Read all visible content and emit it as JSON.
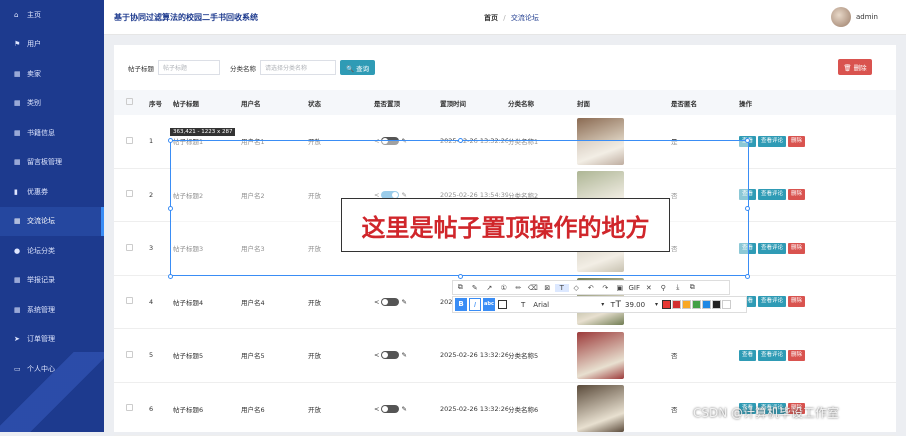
{
  "app_title": "基于协同过滤算法的校园二手书回收系统",
  "header": {
    "crumb_home": "首页",
    "crumb_sep": "/",
    "crumb_current": "交流论坛",
    "username": "admin"
  },
  "sidebar": {
    "items": [
      {
        "icon": "⌂",
        "label": "主页"
      },
      {
        "icon": "⚑",
        "label": "用户"
      },
      {
        "icon": "▦",
        "label": "卖家"
      },
      {
        "icon": "▦",
        "label": "类别"
      },
      {
        "icon": "▦",
        "label": "书籍信息"
      },
      {
        "icon": "▦",
        "label": "留言板管理"
      },
      {
        "icon": "▮",
        "label": "优惠券"
      },
      {
        "icon": "▦",
        "label": "交流论坛"
      },
      {
        "icon": "●",
        "label": "论坛分类"
      },
      {
        "icon": "▦",
        "label": "举报记录"
      },
      {
        "icon": "▦",
        "label": "系统管理"
      },
      {
        "icon": "➤",
        "label": "订单管理"
      },
      {
        "icon": "▭",
        "label": "个人中心"
      }
    ]
  },
  "search": {
    "title_label": "帖子标题",
    "title_placeholder": "帖子标题",
    "category_label": "分类名称",
    "category_placeholder": "请选择分类名称",
    "button": "🔍 查询"
  },
  "delete_button": "🗑 删除",
  "table": {
    "headers": [
      "序号",
      "帖子标题",
      "用户名",
      "状态",
      "是否置顶",
      "置顶时间",
      "分类名称",
      "封面",
      "是否匿名",
      "操作"
    ],
    "rows": [
      {
        "no": "1",
        "title": "帖子标题1",
        "user": "用户名1",
        "status": "开放",
        "pin_time": "2025-02-26 13:32:26",
        "category": "分类名称1",
        "anon": "是",
        "pinned": false,
        "cover": "#8a6a52"
      },
      {
        "no": "2",
        "title": "帖子标题2",
        "user": "用户名2",
        "status": "开放",
        "pin_time": "2025-02-26 13:54:39",
        "category": "分类名称2",
        "anon": "否",
        "pinned": true,
        "cover": "#6b7a3e"
      },
      {
        "no": "3",
        "title": "帖子标题3",
        "user": "用户名3",
        "status": "开放",
        "pin_time": "2025-02-26 13:32:26",
        "category": "分类名称3",
        "anon": "否",
        "pinned": false,
        "cover": "#9a8f70"
      },
      {
        "no": "4",
        "title": "帖子标题4",
        "user": "用户名4",
        "status": "开放",
        "pin_time": "2025-02-26 13:32:26",
        "category": "分类名称4",
        "anon": "否",
        "pinned": false,
        "cover": "#707c52"
      },
      {
        "no": "5",
        "title": "帖子标题5",
        "user": "用户名5",
        "status": "开放",
        "pin_time": "2025-02-26 13:32:26",
        "category": "分类名称5",
        "anon": "否",
        "pinned": false,
        "cover": "#9c3a3a"
      },
      {
        "no": "6",
        "title": "帖子标题6",
        "user": "用户名6",
        "status": "开放",
        "pin_time": "2025-02-26 13:32:26",
        "category": "分类名称6",
        "anon": "否",
        "pinned": false,
        "cover": "#5a4a3a"
      }
    ],
    "actions": {
      "view": "查看",
      "comments": "查看评论",
      "delete": "删除"
    }
  },
  "overlay": {
    "size_label": "363,421 - 1223 x 287",
    "note": "这里是帖子置顶操作的地方",
    "toolbar_icons": [
      "⧉",
      "✎",
      "↗",
      "①",
      "✏",
      "⌫",
      "⊠",
      "T",
      "◇",
      "↶",
      "↷",
      "▣",
      "GIF",
      "✕",
      "⚲",
      "⤓",
      "⧉"
    ],
    "font": "Arial",
    "font_size": "39.00",
    "colors": [
      "#e53935",
      "#d32f2f",
      "#f9a825",
      "#43a047",
      "#1e88e5",
      "#212121",
      "#ffffff"
    ]
  },
  "watermark": "CSDN @计算机毕设工作室"
}
